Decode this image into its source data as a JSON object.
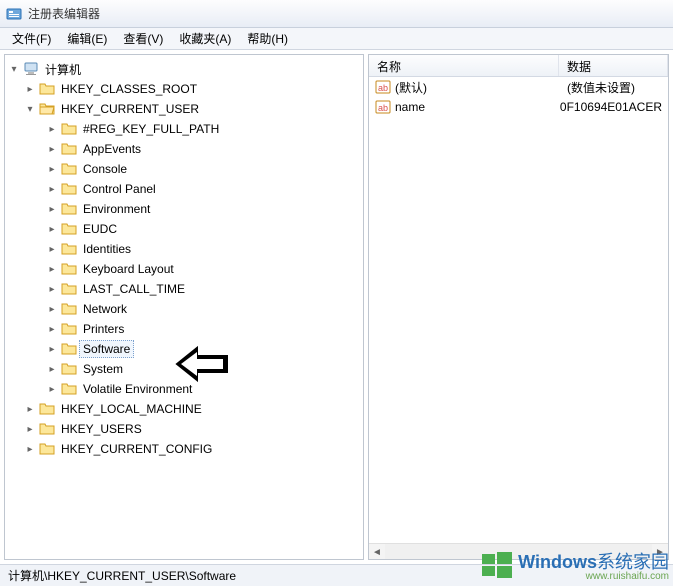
{
  "window": {
    "title": "注册表编辑器"
  },
  "menu": {
    "file": "文件(F)",
    "edit": "编辑(E)",
    "view": "查看(V)",
    "fav": "收藏夹(A)",
    "help": "帮助(H)"
  },
  "tree": {
    "root": "计算机",
    "hkcr": "HKEY_CLASSES_ROOT",
    "hkcu": "HKEY_CURRENT_USER",
    "children": [
      "#REG_KEY_FULL_PATH",
      "AppEvents",
      "Console",
      "Control Panel",
      "Environment",
      "EUDC",
      "Identities",
      "Keyboard Layout",
      "LAST_CALL_TIME",
      "Network",
      "Printers",
      "Software",
      "System",
      "Volatile Environment"
    ],
    "hklm": "HKEY_LOCAL_MACHINE",
    "hku": "HKEY_USERS",
    "hkcc": "HKEY_CURRENT_CONFIG",
    "selected": "Software"
  },
  "list": {
    "col_name": "名称",
    "col_data": "数据",
    "rows": [
      {
        "name": "(默认)",
        "data": "(数值未设置)"
      },
      {
        "name": "name",
        "data": "0F10694E01ACER"
      }
    ]
  },
  "statusbar": {
    "path": "计算机\\HKEY_CURRENT_USER\\Software"
  },
  "watermark": {
    "brand_bold": "Windows",
    "brand_rest": "系统家园",
    "url": "www.ruishaifu.com"
  }
}
